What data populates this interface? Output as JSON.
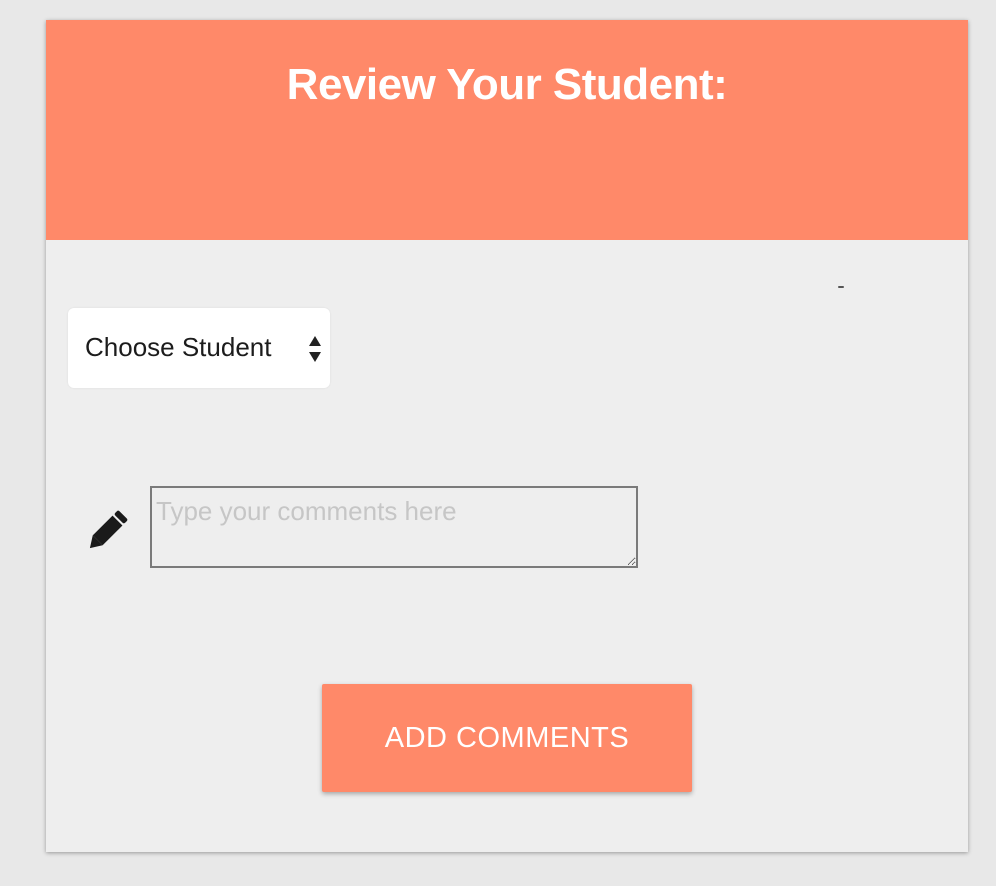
{
  "card": {
    "title": "Review Your Student:"
  },
  "student_select": {
    "selected": "Choose Student",
    "icon": "updown-arrows-icon"
  },
  "comment": {
    "placeholder": "Type your comments here",
    "value": "",
    "icon": "pencil-icon"
  },
  "actions": {
    "add_label": "ADD COMMENTS"
  },
  "colors": {
    "accent": "#ff8969",
    "background": "#eeeeee",
    "text": "#1c1c1c",
    "button_text": "#ffffff",
    "placeholder": "#c6c6c6"
  }
}
